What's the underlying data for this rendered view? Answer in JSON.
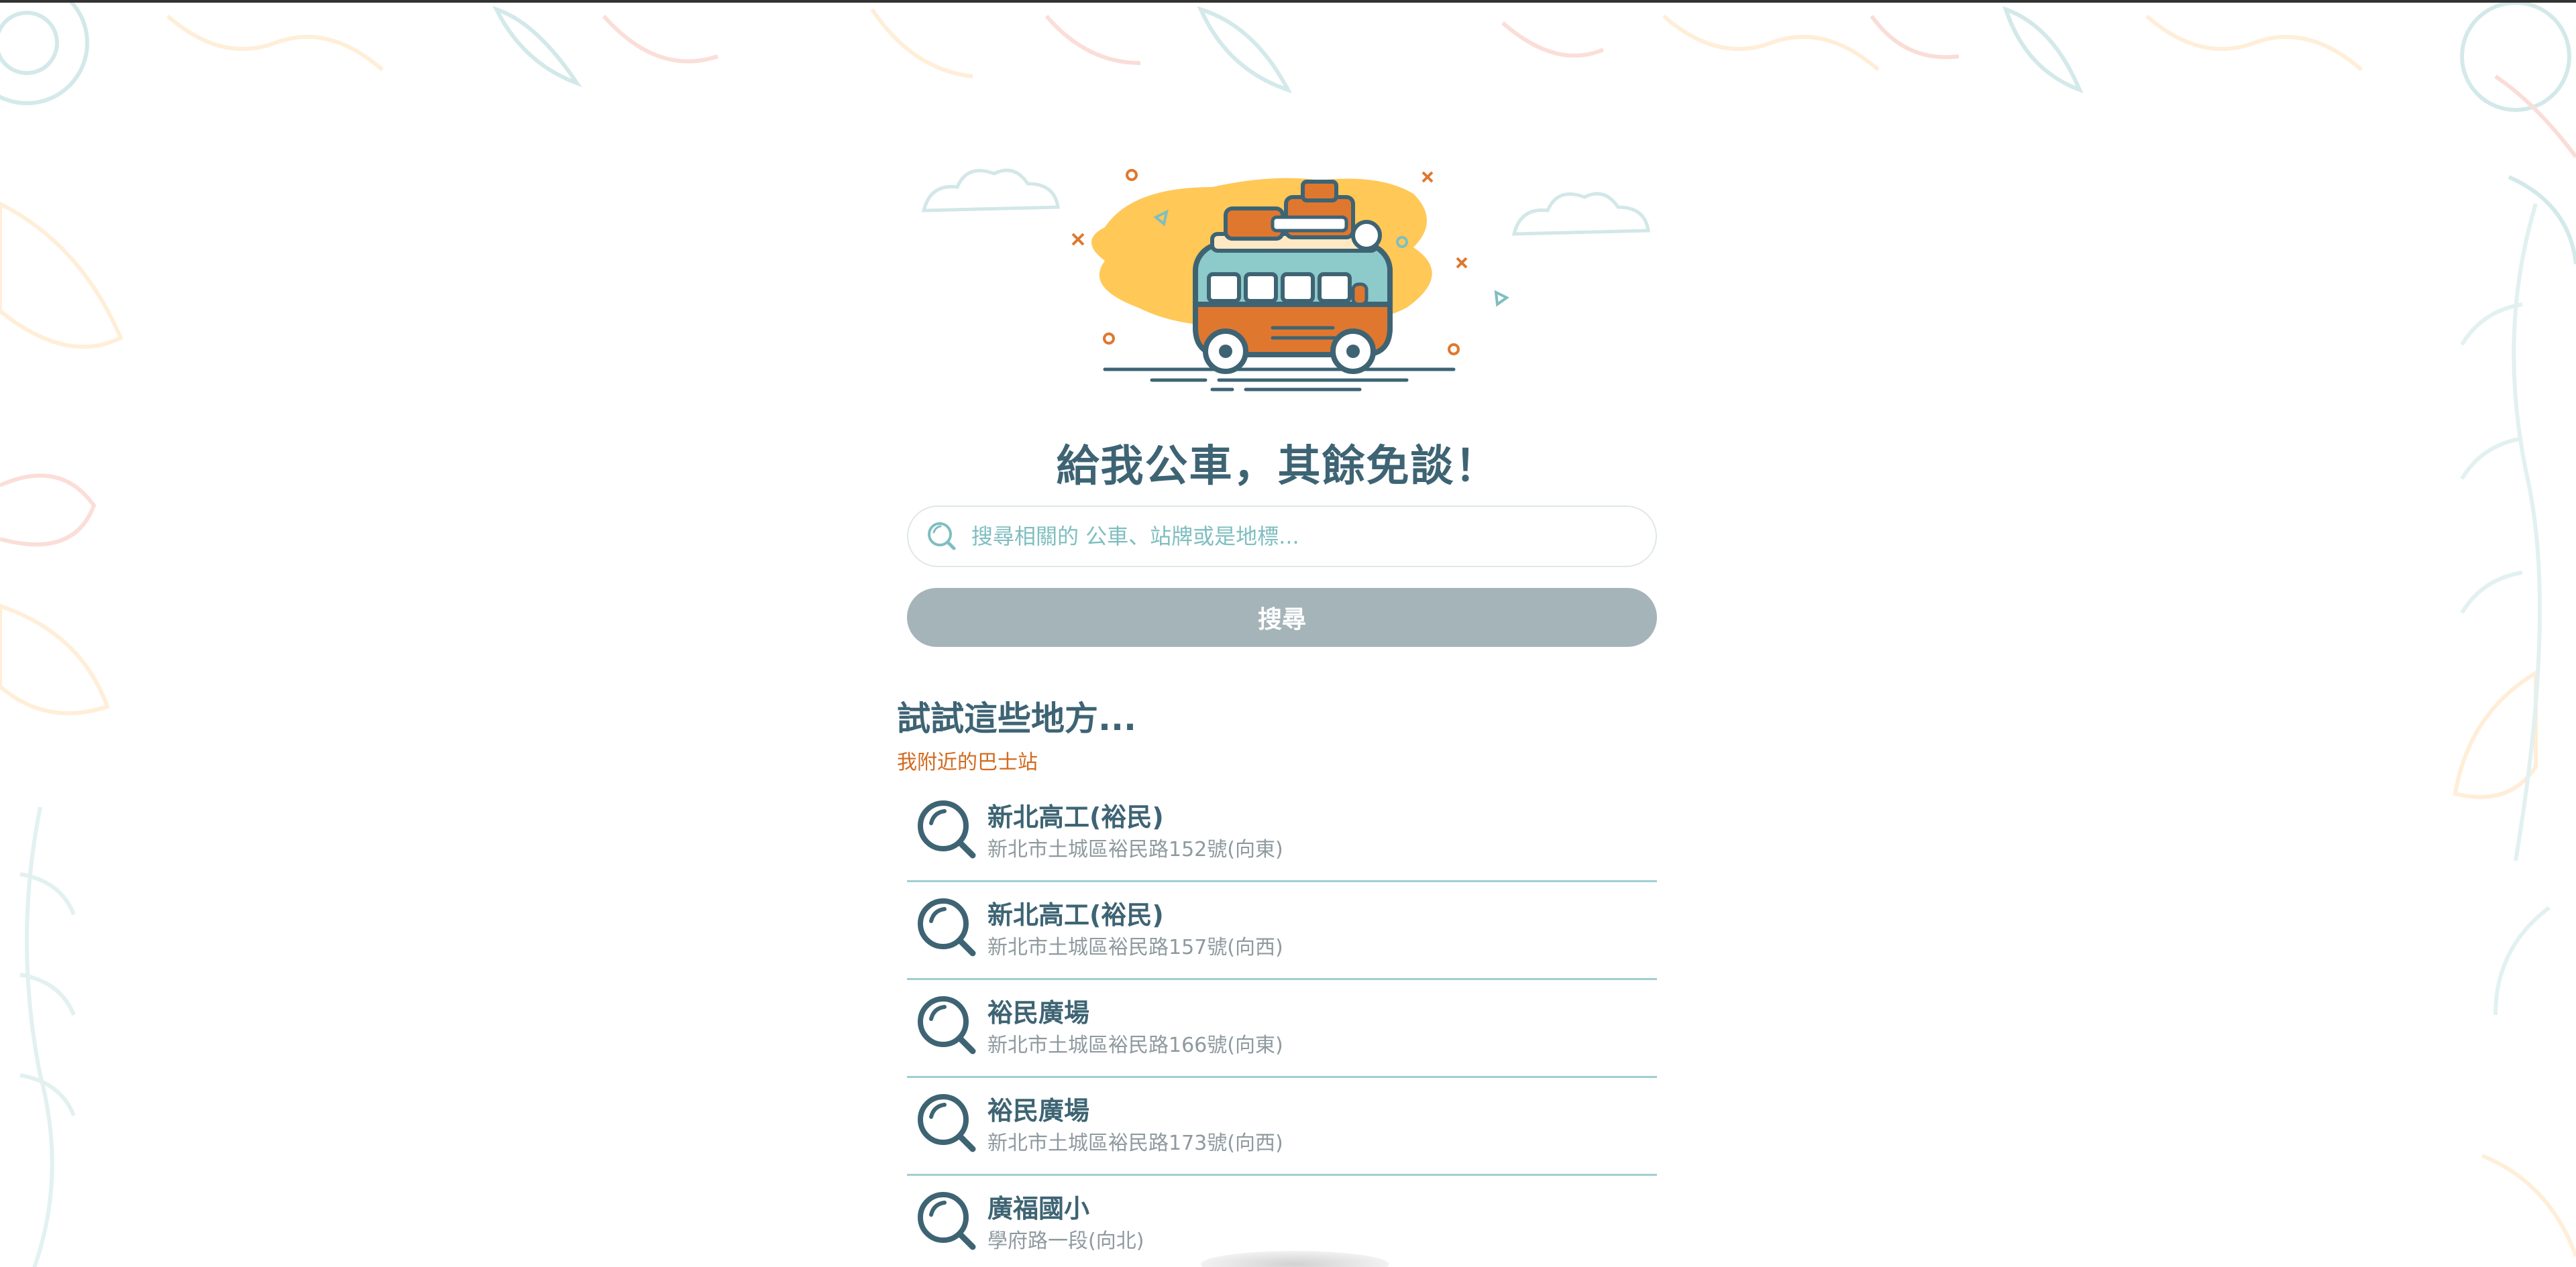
{
  "page": {
    "title": "給我公車，其餘免談！"
  },
  "search": {
    "placeholder": "搜尋相關的 公車、站牌或是地標...",
    "button_label": "搜尋"
  },
  "suggestions": {
    "heading": "試試這些地方...",
    "nearby_label": "我附近的巴士站",
    "stops": [
      {
        "name": "新北高工(裕民)",
        "address": "新北市土城區裕民路152號(向東)"
      },
      {
        "name": "新北高工(裕民)",
        "address": "新北市土城區裕民路157號(向西)"
      },
      {
        "name": "裕民廣場",
        "address": "新北市土城區裕民路166號(向東)"
      },
      {
        "name": "裕民廣場",
        "address": "新北市土城區裕民路173號(向西)"
      },
      {
        "name": "廣福國小",
        "address": "學府路一段(向北)"
      }
    ]
  },
  "icons": {
    "search": "search-icon",
    "stop": "magnifier-icon",
    "hero": "bus-illustration"
  },
  "colors": {
    "primary_text": "#3e6474",
    "accent_orange": "#d26a1e",
    "teal": "#7fbec0",
    "button_disabled": "#a5b4b9",
    "hero_yellow": "#ffc857"
  }
}
